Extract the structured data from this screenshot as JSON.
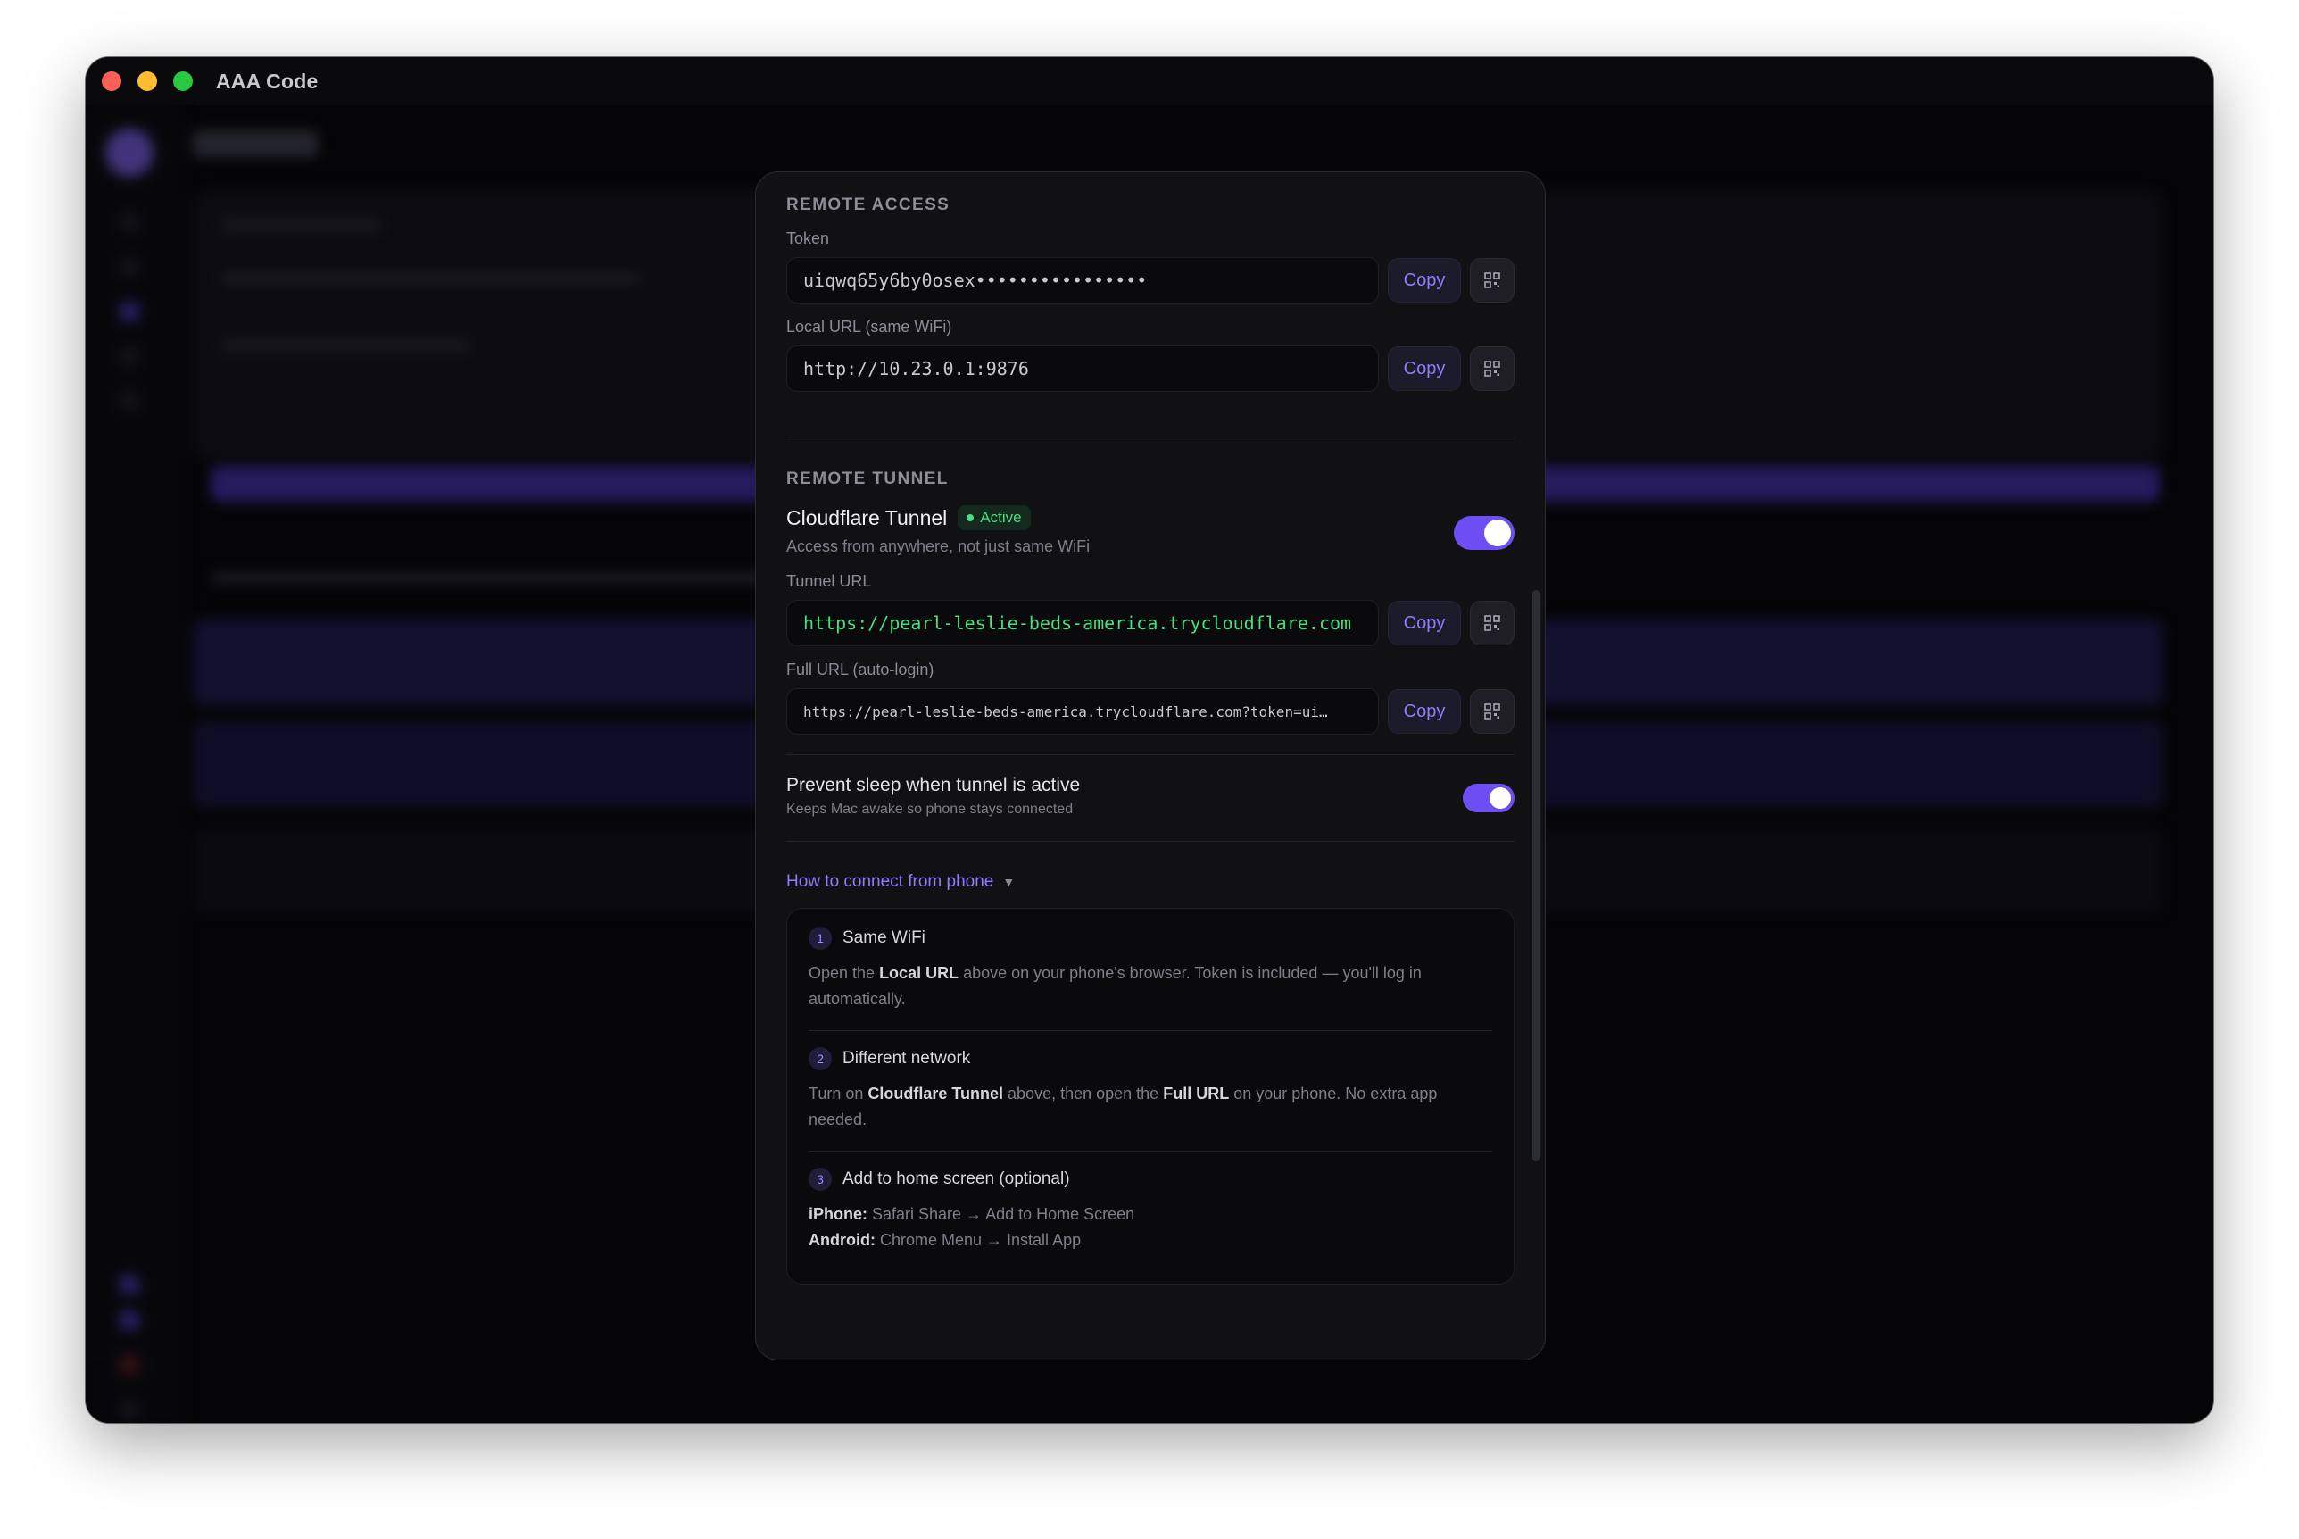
{
  "window": {
    "title": "AAA Code"
  },
  "remote_access": {
    "section_title": "REMOTE ACCESS",
    "token": {
      "label": "Token",
      "value": "uiqwq65y6by0osex••••••••••••••••",
      "copy_label": "Copy"
    },
    "local_url": {
      "label": "Local URL (same WiFi)",
      "value": "http://10.23.0.1:9876",
      "copy_label": "Copy"
    }
  },
  "remote_tunnel": {
    "section_title": "REMOTE TUNNEL",
    "cloudflare": {
      "name": "Cloudflare Tunnel",
      "status": "Active",
      "description": "Access from anywhere, not just same WiFi",
      "enabled": true
    },
    "tunnel_url": {
      "label": "Tunnel URL",
      "value": "https://pearl-leslie-beds-america.trycloudflare.com",
      "copy_label": "Copy"
    },
    "full_url": {
      "label": "Full URL (auto-login)",
      "value": "https://pearl-leslie-beds-america.trycloudflare.com?token=ui…",
      "copy_label": "Copy"
    },
    "prevent_sleep": {
      "title": "Prevent sleep when tunnel is active",
      "description": "Keeps Mac awake so phone stays connected",
      "enabled": true
    }
  },
  "howto": {
    "link_label": "How to connect from phone",
    "caret": "▼",
    "steps": [
      {
        "num": "1",
        "title": "Same WiFi",
        "t1": "Open the ",
        "b1": "Local URL",
        "t2": " above on your phone's browser. Token is included — you'll log in automatically."
      },
      {
        "num": "2",
        "title": "Different network",
        "t1": "Turn on ",
        "b1": "Cloudflare Tunnel",
        "t2": " above, then open the ",
        "b2": "Full URL",
        "t3": " on your phone. No extra app needed."
      },
      {
        "num": "3",
        "title": "Add to home screen (optional)",
        "iphone_label": "iPhone:",
        "iphone_text": " Safari Share → Add to Home Screen",
        "android_label": "Android:",
        "android_text": " Chrome Menu → Install App"
      }
    ]
  },
  "colors": {
    "accent": "#8f7cff",
    "toggle_on": "#6d4ef2",
    "success": "#4ade80",
    "panel_bg": "#111114",
    "window_bg": "#050507"
  }
}
